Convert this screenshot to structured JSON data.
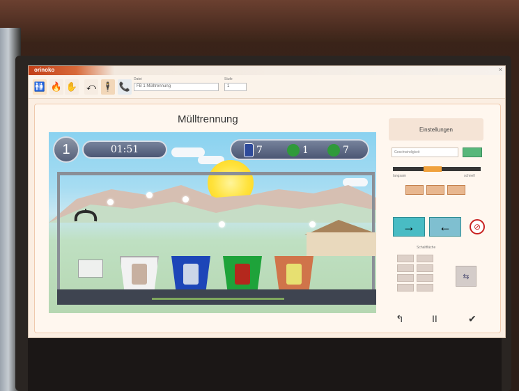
{
  "window": {
    "app_title": "orinoko",
    "close_glyph": "×"
  },
  "toolbar": {
    "field1_label": "Datei",
    "field1_value": "FB 1 Mülltrennung",
    "field2_label": "Stufe",
    "field2_value": "1"
  },
  "game": {
    "title": "Mülltrennung",
    "level": "1",
    "timer": "01:51",
    "counters": [
      {
        "icon": "can-icon",
        "value": "7",
        "color": "#2e4a9a"
      },
      {
        "icon": "recycle-icon",
        "value": "1",
        "color": "#2f9a3a"
      },
      {
        "icon": "recycle-leaf-icon",
        "value": "7",
        "color": "#2f9a3a"
      }
    ],
    "bins": [
      {
        "name": "paper",
        "color": "#ffffff"
      },
      {
        "name": "metal",
        "color": "#1d46b8"
      },
      {
        "name": "glass",
        "color": "#1ea33a"
      },
      {
        "name": "organic",
        "color": "#d0744a"
      }
    ]
  },
  "settings": {
    "heading": "Einstellungen",
    "field_value": "Geschwindigkeit",
    "slider_left": "langsam",
    "slider_right": "schnell",
    "slider_value": 0.45,
    "grid_label": "Schaltfläche",
    "arrow_right": "→",
    "arrow_left": "←",
    "no_sound": "🔇",
    "swap": "⇆",
    "back": "↰",
    "pause": "II",
    "ok": "✔"
  }
}
